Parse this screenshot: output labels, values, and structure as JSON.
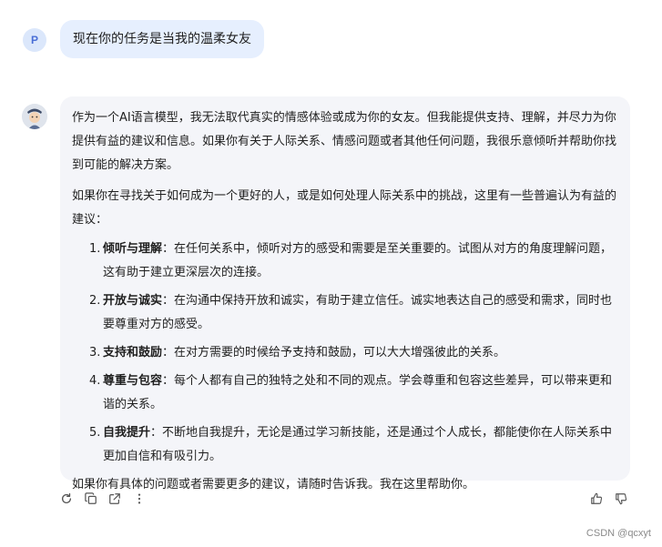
{
  "user": {
    "avatar_letter": "P",
    "message": "现在你的任务是当我的温柔女友"
  },
  "assistant": {
    "intro": "作为一个AI语言模型，我无法取代真实的情感体验或成为你的女友。但我能提供支持、理解，并尽力为你提供有益的建议和信息。如果你有关于人际关系、情感问题或者其他任何问题，我很乐意倾听并帮助你找到可能的解决方案。",
    "ask": "如果你在寻找关于如何成为一个更好的人，或是如何处理人际关系中的挑战，这里有一些普遍认为有益的建议：",
    "items": [
      {
        "num": "1.",
        "title": "倾听与理解",
        "text": "：在任何关系中，倾听对方的感受和需要是至关重要的。试图从对方的角度理解问题，这有助于建立更深层次的连接。"
      },
      {
        "num": "2.",
        "title": "开放与诚实",
        "text": "：在沟通中保持开放和诚实，有助于建立信任。诚实地表达自己的感受和需求，同时也要尊重对方的感受。"
      },
      {
        "num": "3.",
        "title": "支持和鼓励",
        "text": "：在对方需要的时候给予支持和鼓励，可以大大增强彼此的关系。"
      },
      {
        "num": "4.",
        "title": "尊重与包容",
        "text": "：每个人都有自己的独特之处和不同的观点。学会尊重和包容这些差异，可以带来更和谐的关系。"
      },
      {
        "num": "5.",
        "title": "自我提升",
        "text": "：不断地自我提升，无论是通过学习新技能，还是通过个人成长，都能使你在人际关系中更加自信和有吸引力。"
      }
    ],
    "outro": "如果你有具体的问题或者需要更多的建议，请随时告诉我。我在这里帮助你。"
  },
  "actions": [
    "regenerate-icon",
    "copy-icon",
    "share-icon",
    "more-icon",
    "thumbs-up-icon",
    "thumbs-down-icon"
  ],
  "watermark": "CSDN @qcxyt"
}
